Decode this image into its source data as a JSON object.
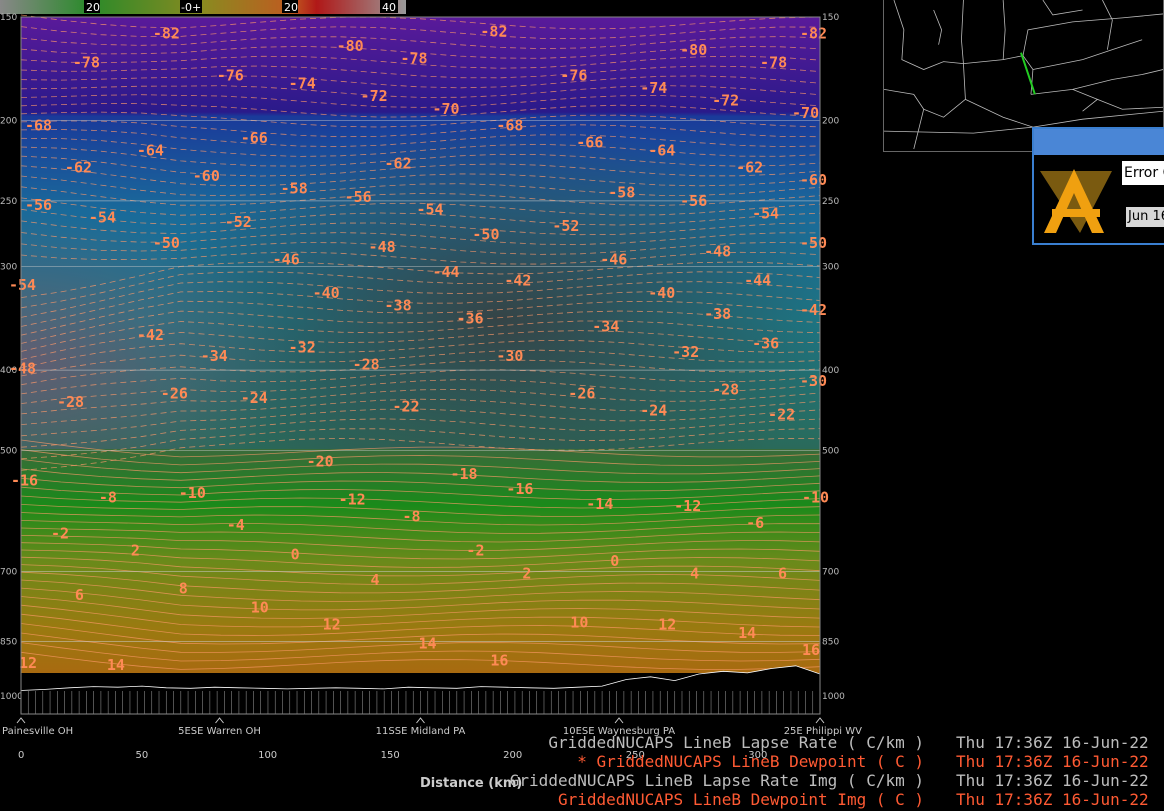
{
  "colorbar": {
    "ticks": [
      "20",
      "-0+",
      "20",
      "40"
    ],
    "stops": [
      "#888888",
      "#2a8a2a",
      "#7a7a20",
      "#c05a20",
      "#b01818",
      "#9a9a9a"
    ]
  },
  "chart_data": {
    "type": "heatmap",
    "title": "",
    "xlabel": "Distance (km)",
    "ylabel": "",
    "x_ticks": [
      0,
      50,
      100,
      150,
      200,
      250,
      300
    ],
    "xlim": [
      0,
      326
    ],
    "y_ticks": [
      150,
      200,
      250,
      300,
      400,
      500,
      700,
      850,
      1000
    ],
    "ylim": [
      1000,
      150
    ],
    "y_scale": "log",
    "grid": true,
    "locations": [
      {
        "name": "Painesville OH",
        "km": 0
      },
      {
        "name": "5ESE Warren OH",
        "km": 81
      },
      {
        "name": "11SSE Midland PA",
        "km": 163
      },
      {
        "name": "10ESE Waynesburg PA",
        "km": 244
      },
      {
        "name": "25E Philippi WV",
        "km": 326
      }
    ],
    "contour_labels": [
      {
        "v": "-82",
        "x": 0.18,
        "y": 0.02
      },
      {
        "v": "-80",
        "x": 0.41,
        "y": 0.05
      },
      {
        "v": "-82",
        "x": 0.59,
        "y": 0.015
      },
      {
        "v": "-80",
        "x": 0.84,
        "y": 0.06
      },
      {
        "v": "-82",
        "x": 0.99,
        "y": 0.02
      },
      {
        "v": "-78",
        "x": 0.08,
        "y": 0.09
      },
      {
        "v": "-76",
        "x": 0.26,
        "y": 0.12
      },
      {
        "v": "-78",
        "x": 0.49,
        "y": 0.08
      },
      {
        "v": "-76",
        "x": 0.69,
        "y": 0.12
      },
      {
        "v": "-78",
        "x": 0.94,
        "y": 0.09
      },
      {
        "v": "-74",
        "x": 0.35,
        "y": 0.14
      },
      {
        "v": "-72",
        "x": 0.44,
        "y": 0.17
      },
      {
        "v": "-70",
        "x": 0.53,
        "y": 0.2
      },
      {
        "v": "-74",
        "x": 0.79,
        "y": 0.15
      },
      {
        "v": "-72",
        "x": 0.88,
        "y": 0.18
      },
      {
        "v": "-70",
        "x": 0.98,
        "y": 0.21
      },
      {
        "v": "-68",
        "x": 0.02,
        "y": 0.24
      },
      {
        "v": "-66",
        "x": 0.29,
        "y": 0.27
      },
      {
        "v": "-68",
        "x": 0.61,
        "y": 0.24
      },
      {
        "v": "-66",
        "x": 0.71,
        "y": 0.28
      },
      {
        "v": "-64",
        "x": 0.16,
        "y": 0.3
      },
      {
        "v": "-64",
        "x": 0.8,
        "y": 0.3
      },
      {
        "v": "-62",
        "x": 0.07,
        "y": 0.34
      },
      {
        "v": "-62",
        "x": 0.47,
        "y": 0.33
      },
      {
        "v": "-62",
        "x": 0.91,
        "y": 0.34
      },
      {
        "v": "-60",
        "x": 0.23,
        "y": 0.36
      },
      {
        "v": "-60",
        "x": 0.99,
        "y": 0.37
      },
      {
        "v": "-58",
        "x": 0.34,
        "y": 0.39
      },
      {
        "v": "-58",
        "x": 0.75,
        "y": 0.4
      },
      {
        "v": "-56",
        "x": 0.02,
        "y": 0.43
      },
      {
        "v": "-56",
        "x": 0.42,
        "y": 0.41
      },
      {
        "v": "-56",
        "x": 0.84,
        "y": 0.42
      },
      {
        "v": "-54",
        "x": 0.1,
        "y": 0.46
      },
      {
        "v": "-54",
        "x": 0.51,
        "y": 0.44
      },
      {
        "v": "-54",
        "x": 0.93,
        "y": 0.45
      },
      {
        "v": "-52",
        "x": 0.27,
        "y": 0.47
      },
      {
        "v": "-52",
        "x": 0.68,
        "y": 0.48
      },
      {
        "v": "-50",
        "x": 0.18,
        "y": 0.52
      },
      {
        "v": "-50",
        "x": 0.58,
        "y": 0.5
      },
      {
        "v": "-50",
        "x": 0.99,
        "y": 0.52
      },
      {
        "v": "-48",
        "x": 0.45,
        "y": 0.53
      },
      {
        "v": "-48",
        "x": 0.87,
        "y": 0.54
      },
      {
        "v": "-46",
        "x": 0.33,
        "y": 0.56
      },
      {
        "v": "-46",
        "x": 0.74,
        "y": 0.56
      },
      {
        "v": "-44",
        "x": 0.53,
        "y": 0.59
      },
      {
        "v": "-44",
        "x": 0.92,
        "y": 0.61
      },
      {
        "v": "-54",
        "x": 0.0,
        "y": 0.62
      },
      {
        "v": "-42",
        "x": 0.62,
        "y": 0.61
      },
      {
        "v": "-42",
        "x": 0.99,
        "y": 0.68
      },
      {
        "v": "-40",
        "x": 0.38,
        "y": 0.64
      },
      {
        "v": "-40",
        "x": 0.8,
        "y": 0.64
      },
      {
        "v": "-38",
        "x": 0.47,
        "y": 0.67
      },
      {
        "v": "-38",
        "x": 0.87,
        "y": 0.69
      },
      {
        "v": "-36",
        "x": 0.56,
        "y": 0.7
      },
      {
        "v": "-36",
        "x": 0.93,
        "y": 0.76
      },
      {
        "v": "-34",
        "x": 0.73,
        "y": 0.72
      },
      {
        "v": "-42",
        "x": 0.16,
        "y": 0.74
      },
      {
        "v": "-32",
        "x": 0.35,
        "y": 0.77
      },
      {
        "v": "-32",
        "x": 0.83,
        "y": 0.78
      },
      {
        "v": "-34",
        "x": 0.24,
        "y": 0.79
      },
      {
        "v": "-30",
        "x": 0.61,
        "y": 0.79
      },
      {
        "v": "-48",
        "x": 0.0,
        "y": 0.82
      },
      {
        "v": "-28",
        "x": 0.43,
        "y": 0.81
      },
      {
        "v": "-30",
        "x": 0.99,
        "y": 0.85
      },
      {
        "v": "-28",
        "x": 0.88,
        "y": 0.87
      },
      {
        "v": "-26",
        "x": 0.19,
        "y": 0.88
      },
      {
        "v": "-26",
        "x": 0.7,
        "y": 0.88
      },
      {
        "v": "-28",
        "x": 0.06,
        "y": 0.9
      },
      {
        "v": "-24",
        "x": 0.29,
        "y": 0.89
      },
      {
        "v": "-24",
        "x": 0.79,
        "y": 0.92
      },
      {
        "v": "-22",
        "x": 0.48,
        "y": 0.91
      },
      {
        "v": "-22",
        "x": 0.95,
        "y": 0.93
      }
    ],
    "contour_labels_lower": [
      {
        "v": "-20",
        "x": 0.37,
        "y": 0.03
      },
      {
        "v": "-18",
        "x": 0.55,
        "y": 0.09
      },
      {
        "v": "-16",
        "x": 0.0,
        "y": 0.12
      },
      {
        "v": "-16",
        "x": 0.62,
        "y": 0.16
      },
      {
        "v": "-14",
        "x": 0.72,
        "y": 0.23
      },
      {
        "v": "-12",
        "x": 0.41,
        "y": 0.21
      },
      {
        "v": "-12",
        "x": 0.83,
        "y": 0.24
      },
      {
        "v": "-10",
        "x": 0.21,
        "y": 0.18
      },
      {
        "v": "-10",
        "x": 0.99,
        "y": 0.2
      },
      {
        "v": "-8",
        "x": 0.11,
        "y": 0.2
      },
      {
        "v": "-8",
        "x": 0.49,
        "y": 0.29
      },
      {
        "v": "-6",
        "x": 0.92,
        "y": 0.32
      },
      {
        "v": "-4",
        "x": 0.27,
        "y": 0.33
      },
      {
        "v": "-2",
        "x": 0.05,
        "y": 0.37
      },
      {
        "v": "-2",
        "x": 0.57,
        "y": 0.45
      },
      {
        "v": "2",
        "x": 0.15,
        "y": 0.45
      },
      {
        "v": "0",
        "x": 0.35,
        "y": 0.47
      },
      {
        "v": "0",
        "x": 0.75,
        "y": 0.5
      },
      {
        "v": "2",
        "x": 0.64,
        "y": 0.56
      },
      {
        "v": "4",
        "x": 0.45,
        "y": 0.59
      },
      {
        "v": "4",
        "x": 0.85,
        "y": 0.56
      },
      {
        "v": "6",
        "x": 0.08,
        "y": 0.66
      },
      {
        "v": "6",
        "x": 0.96,
        "y": 0.56
      },
      {
        "v": "8",
        "x": 0.21,
        "y": 0.63
      },
      {
        "v": "10",
        "x": 0.3,
        "y": 0.72
      },
      {
        "v": "10",
        "x": 0.7,
        "y": 0.79
      },
      {
        "v": "12",
        "x": 0.39,
        "y": 0.8
      },
      {
        "v": "12",
        "x": 0.81,
        "y": 0.8
      },
      {
        "v": "14",
        "x": 0.51,
        "y": 0.89
      },
      {
        "v": "14",
        "x": 0.91,
        "y": 0.84
      },
      {
        "v": "16",
        "x": 0.6,
        "y": 0.97
      },
      {
        "v": "16",
        "x": 0.99,
        "y": 0.92
      },
      {
        "v": "12",
        "x": 0.01,
        "y": 0.98
      },
      {
        "v": "14",
        "x": 0.12,
        "y": 0.99
      }
    ],
    "terrain_profile_hpa": [
      990,
      988,
      985,
      983,
      984,
      982,
      985,
      986,
      984,
      985,
      986,
      987,
      986,
      985,
      986,
      987,
      984,
      985,
      986,
      983,
      984,
      985,
      986,
      984,
      982,
      970,
      965,
      972,
      960,
      955,
      958,
      950,
      945,
      960
    ]
  },
  "legend": {
    "rows": [
      {
        "name": "GriddedNUCAPS LineB Lapse Rate ( C/km )",
        "time": "Thu 17:36Z 16-Jun-22",
        "color": "#bdbdbd"
      },
      {
        "name": "* GriddedNUCAPS LineB Dewpoint ( C )",
        "time": "Thu 17:36Z 16-Jun-22",
        "color": "#ff5a33"
      },
      {
        "name": "GriddedNUCAPS LineB Lapse Rate Img ( C/km )",
        "time": "Thu 17:36Z 16-Jun-22",
        "color": "#bdbdbd"
      },
      {
        "name": "GriddedNUCAPS LineB Dewpoint Img ( C )",
        "time": "Thu 17:36Z 16-Jun-22",
        "color": "#ff5a33"
      }
    ]
  },
  "axis_title": "Distance (km)",
  "error_dialog": {
    "field_text": "Error C",
    "date_text": "Jun 16"
  }
}
